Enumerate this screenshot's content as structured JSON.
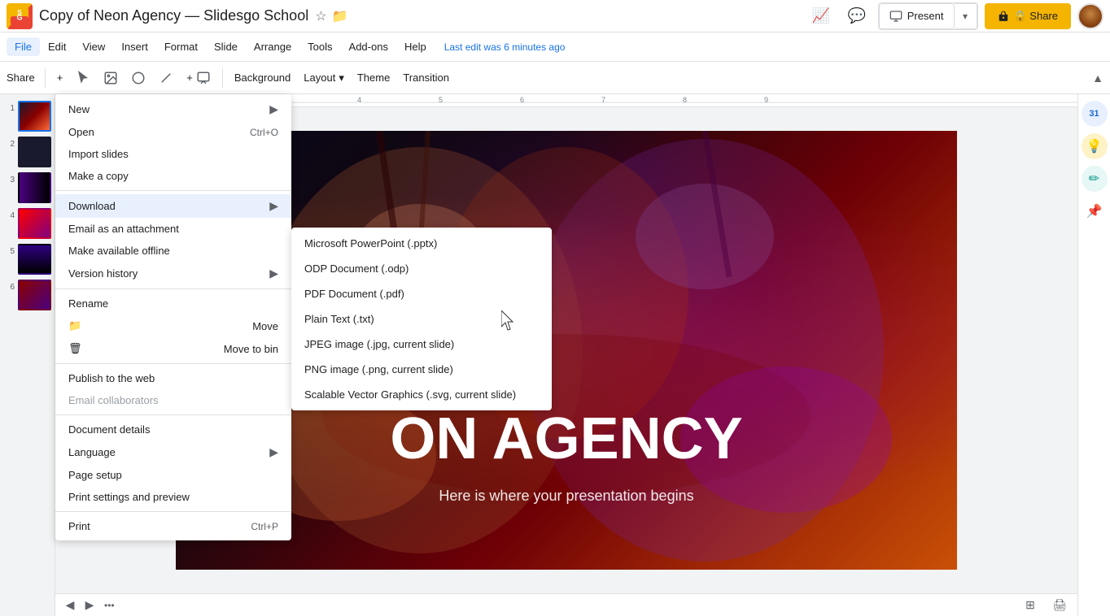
{
  "titlebar": {
    "app_icon": "G",
    "doc_title": "Copy of Neon Agency — Slidesgo School",
    "star_icon": "☆",
    "folder_icon": "📁",
    "chart_icon": "📈",
    "comment_icon": "💬",
    "present_label": "Present",
    "share_label": "🔒 Share",
    "present_dropdown_icon": "▼"
  },
  "menubar": {
    "items": [
      {
        "label": "File",
        "active": true
      },
      {
        "label": "Edit"
      },
      {
        "label": "View"
      },
      {
        "label": "Insert"
      },
      {
        "label": "Format"
      },
      {
        "label": "Slide"
      },
      {
        "label": "Arrange"
      },
      {
        "label": "Tools"
      },
      {
        "label": "Add-ons"
      },
      {
        "label": "Help"
      }
    ],
    "last_edit": "Last edit was 6 minutes ago"
  },
  "toolbar": {
    "share_label": "Share",
    "plus_icon": "+",
    "background_label": "Background",
    "layout_label": "Layout",
    "layout_arrow": "▾",
    "theme_label": "Theme",
    "transition_label": "Transition",
    "chevron_up": "▲"
  },
  "file_menu": {
    "items": [
      {
        "label": "New",
        "shortcut": "",
        "has_arrow": true
      },
      {
        "label": "Open",
        "shortcut": "Ctrl+O",
        "has_arrow": false
      },
      {
        "label": "Import slides",
        "shortcut": "",
        "has_arrow": false
      },
      {
        "label": "Make a copy",
        "shortcut": "",
        "has_arrow": false
      },
      {
        "separator": true
      },
      {
        "label": "Download",
        "shortcut": "",
        "has_arrow": true,
        "active": true
      },
      {
        "label": "Email as an attachment",
        "shortcut": "",
        "has_arrow": false
      },
      {
        "label": "Make available offline",
        "shortcut": "",
        "has_arrow": false
      },
      {
        "label": "Version history",
        "shortcut": "",
        "has_arrow": true
      },
      {
        "separator": true
      },
      {
        "label": "Rename",
        "shortcut": "",
        "has_arrow": false
      },
      {
        "label": "Move",
        "shortcut": "",
        "has_arrow": false,
        "has_folder_icon": true
      },
      {
        "label": "Move to bin",
        "shortcut": "",
        "has_arrow": false,
        "has_bin_icon": true
      },
      {
        "separator": true
      },
      {
        "label": "Publish to the web",
        "shortcut": "",
        "has_arrow": false
      },
      {
        "label": "Email collaborators",
        "shortcut": "",
        "has_arrow": false,
        "disabled": true
      },
      {
        "separator": true
      },
      {
        "label": "Document details",
        "shortcut": "",
        "has_arrow": false
      },
      {
        "label": "Language",
        "shortcut": "",
        "has_arrow": true
      },
      {
        "label": "Page setup",
        "shortcut": "",
        "has_arrow": false
      },
      {
        "label": "Print settings and preview",
        "shortcut": "",
        "has_arrow": false
      },
      {
        "separator": true
      },
      {
        "label": "Print",
        "shortcut": "Ctrl+P",
        "has_arrow": false
      }
    ]
  },
  "download_submenu": {
    "items": [
      {
        "label": "Microsoft PowerPoint (.pptx)"
      },
      {
        "label": "ODP Document (.odp)"
      },
      {
        "label": "PDF Document (.pdf)"
      },
      {
        "label": "Plain Text (.txt)"
      },
      {
        "label": "JPEG image (.jpg, current slide)"
      },
      {
        "label": "PNG image (.png, current slide)"
      },
      {
        "label": "Scalable Vector Graphics (.svg, current slide)"
      }
    ]
  },
  "slides": [
    {
      "num": "1",
      "active": true
    },
    {
      "num": "2",
      "active": false
    },
    {
      "num": "3",
      "active": false
    },
    {
      "num": "4",
      "active": false
    },
    {
      "num": "5",
      "active": false
    },
    {
      "num": "6",
      "active": false
    }
  ],
  "slide_content": {
    "title": "ON AGENCY",
    "subtitle": "Here is where your presentation begins"
  },
  "bottom_bar": {
    "prev_icon": "◀",
    "next_icon": "▶",
    "dots": "•••",
    "grid_icon": "⊞",
    "print_icon": "🖨"
  },
  "right_sidebar": {
    "calendar_icon": "31",
    "lightbulb_icon": "💡",
    "pencil_icon": "✏",
    "pin_icon": "📌"
  }
}
